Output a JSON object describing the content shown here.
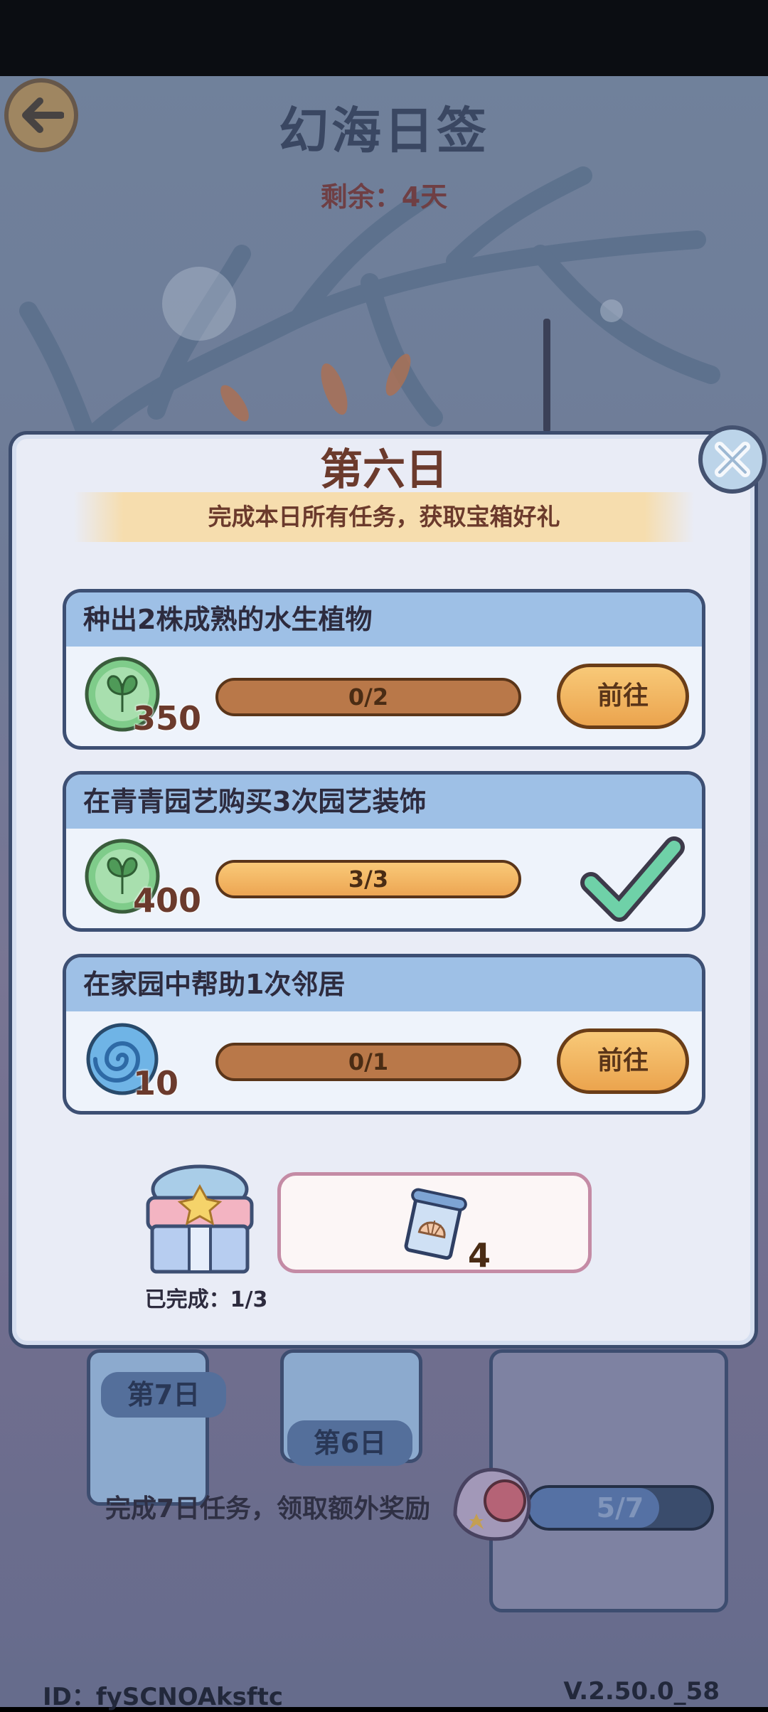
{
  "header": {
    "title": "幻海日签",
    "remaining": "剩余：4天"
  },
  "background_days": {
    "day7": "第7日",
    "day6": "第6日",
    "hint": "完成7日任务，领取额外奖励",
    "progress_text": "5/7",
    "progress_fraction": 0.714
  },
  "footer": {
    "id": "ID：fySCNOAksftc",
    "version": "V.2.50.0_58"
  },
  "dialog": {
    "title": "第六日",
    "subtitle": "完成本日所有任务，获取宝箱好礼",
    "tasks": [
      {
        "title": "种出2株成熟的水生植物",
        "reward_icon": "leaf-coin-icon",
        "reward": "350",
        "progress": "0/2",
        "fraction": 0,
        "action": "前往",
        "done": false
      },
      {
        "title": "在青青园艺购买3次园艺装饰",
        "reward_icon": "leaf-coin-icon",
        "reward": "400",
        "progress": "3/3",
        "fraction": 1,
        "action": "",
        "done": true
      },
      {
        "title": "在家园中帮助1次邻居",
        "reward_icon": "swirl-orb-icon",
        "reward": "10",
        "progress": "0/1",
        "fraction": 0,
        "action": "前往",
        "done": false
      }
    ],
    "completed": "已完成：1/3",
    "chest_reward_count": "4"
  },
  "colors": {
    "accent_orange": "#eda653",
    "frame_navy": "#3d4f73",
    "title_brown": "#6b3a2c"
  }
}
